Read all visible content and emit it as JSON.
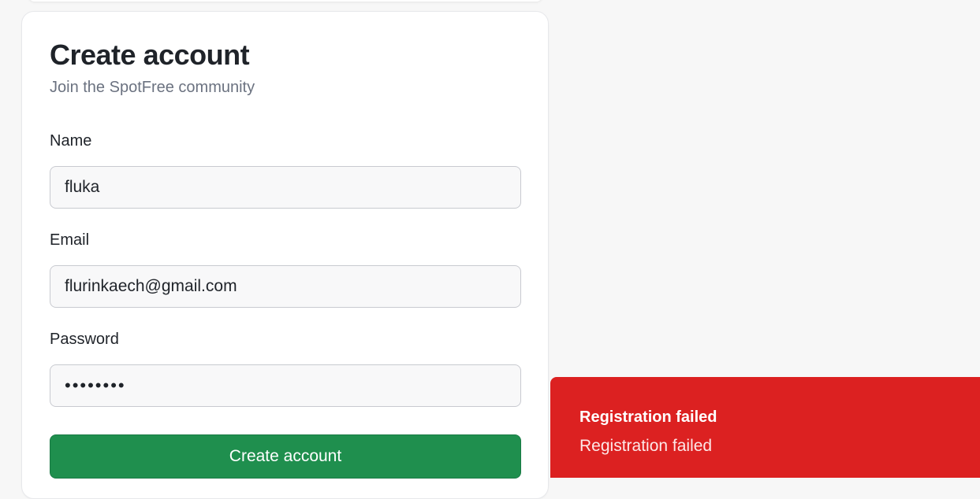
{
  "form": {
    "title": "Create account",
    "subtitle": "Join the SpotFree community",
    "name_label": "Name",
    "name_value": "fluka",
    "email_label": "Email",
    "email_value": "flurinkaech@gmail.com",
    "password_label": "Password",
    "password_value": "••••••••",
    "submit_label": "Create account"
  },
  "toast": {
    "title": "Registration failed",
    "description": "Registration failed"
  },
  "colors": {
    "background": "#f7f7f7",
    "card": "#ffffff",
    "primary_button": "#1f8f4e",
    "error_toast": "#dc2121"
  }
}
